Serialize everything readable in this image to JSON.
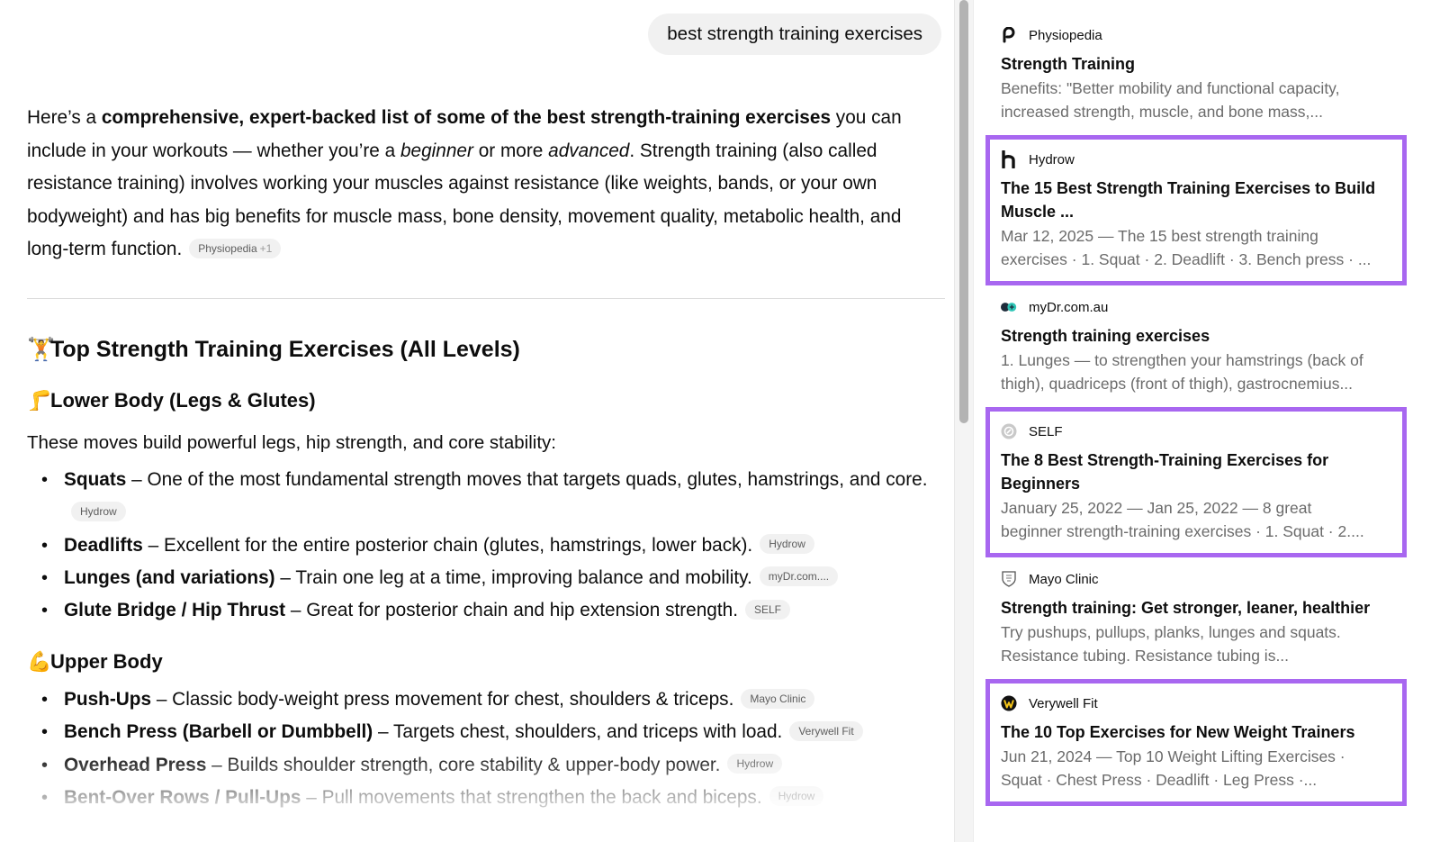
{
  "query": "best strength training exercises",
  "intro": {
    "t1": "Here’s a ",
    "b1": "comprehensive, expert-backed list of some of the best strength-training exercises",
    "t2": " you can include in your workouts — whether you’re a ",
    "i1": "beginner",
    "t3": " or more ",
    "i2": "advanced",
    "t4": ". Strength training (also called resistance training) involves working your muscles against resistance (like weights, bands, or your own bodyweight) and has big benefits for muscle mass, bone density, movement quality, metabolic health, and long-term function.",
    "chip": "Physiopedia",
    "chip_extra": "+1"
  },
  "section_heading": {
    "emoji": "🏋️",
    "text": "Top Strength Training Exercises (All Levels)"
  },
  "lower": {
    "emoji": "🦵",
    "heading": "Lower Body (Legs & Glutes)",
    "intro": "These moves build powerful legs, hip strength, and core stability:",
    "items": [
      {
        "name": "Squats",
        "desc": " – One of the most fundamental strength moves that targets quads, glutes, hamstrings, and core.",
        "source": "Hydrow"
      },
      {
        "name": "Deadlifts",
        "desc": " – Excellent for the entire posterior chain (glutes, hamstrings, lower back).",
        "source": "Hydrow"
      },
      {
        "name": "Lunges (and variations)",
        "desc": " – Train one leg at a time, improving balance and mobility.",
        "source": "myDr.com...."
      },
      {
        "name": "Glute Bridge / Hip Thrust",
        "desc": " – Great for posterior chain and hip extension strength.",
        "source": "SELF"
      }
    ]
  },
  "upper": {
    "emoji": "💪",
    "heading": "Upper Body",
    "items": [
      {
        "name": "Push-Ups",
        "desc": " – Classic body-weight press movement for chest, shoulders & triceps.",
        "source": "Mayo Clinic"
      },
      {
        "name": "Bench Press (Barbell or Dumbbell)",
        "desc": " – Targets chest, shoulders, and triceps with load.",
        "source": "Verywell Fit"
      },
      {
        "name": "Overhead Press",
        "desc": " – Builds shoulder strength, core stability & upper-body power.",
        "source": "Hydrow"
      },
      {
        "name": "Bent-Over Rows / Pull-Ups",
        "desc": " – Pull movements that strengthen the back and biceps.",
        "source": "Hydrow"
      }
    ]
  },
  "sources": [
    {
      "site": "Physiopedia",
      "logo": "physiopedia-logo",
      "title": "Strength Training",
      "snippet1": "Benefits: \"Better mobility and functional capacity,",
      "snippet2": "increased strength, muscle, and bone mass,...",
      "highlighted": false
    },
    {
      "site": "Hydrow",
      "logo": "hydrow-logo",
      "title": "The 15 Best Strength Training Exercises to Build Muscle ...",
      "snippet1": "Mar 12, 2025 — The 15 best strength training",
      "snippet2": "exercises · 1. Squat · 2. Deadlift · 3. Bench press · ...",
      "highlighted": true
    },
    {
      "site": "myDr.com.au",
      "logo": "mydr-logo",
      "title": "Strength training exercises",
      "snippet1": "1. Lunges — to strengthen your hamstrings (back of",
      "snippet2": "thigh), quadriceps (front of thigh), gastrocnemius...",
      "highlighted": false
    },
    {
      "site": "SELF",
      "logo": "self-logo",
      "title": "The 8 Best Strength-Training Exercises for Beginners",
      "snippet1": "January 25, 2022 — Jan 25, 2022 — 8 great",
      "snippet2": "beginner strength-training exercises · 1. Squat · 2....",
      "highlighted": true
    },
    {
      "site": "Mayo Clinic",
      "logo": "mayo-clinic-logo",
      "title": "Strength training: Get stronger, leaner, healthier",
      "snippet1": "Try pushups, pullups, planks, lunges and squats.",
      "snippet2": "Resistance tubing. Resistance tubing is...",
      "highlighted": false
    },
    {
      "site": "Verywell Fit",
      "logo": "verywell-fit-logo",
      "title": "The 10 Top Exercises for New Weight Trainers",
      "snippet1": "Jun 21, 2024 — Top 10 Weight Lifting Exercises ·",
      "snippet2": "Squat · Chest Press · Deadlift · Leg Press ·...",
      "highlighted": true
    }
  ],
  "colors": {
    "highlight": "#a867f0",
    "chip_bg": "#f1f1f1",
    "snippet": "#6b6b6b"
  }
}
